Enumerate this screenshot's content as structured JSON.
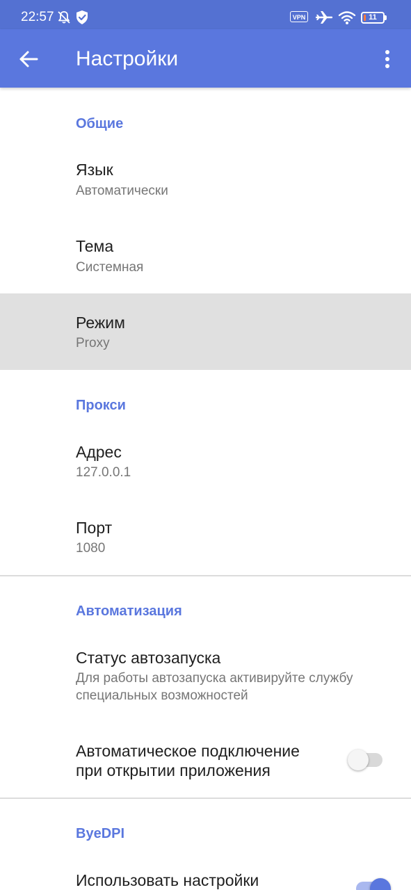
{
  "status_bar": {
    "time": "22:57",
    "vpn_label": "VPN",
    "battery_level": "11",
    "icons": [
      "muted-bell-icon",
      "shield-check-icon",
      "vpn-icon",
      "airplane-icon",
      "wifi-icon",
      "battery-icon"
    ]
  },
  "app_bar": {
    "title": "Настройки",
    "back_icon": "arrow-back-icon",
    "menu_icon": "more-vert-icon"
  },
  "sections": {
    "general": {
      "header": "Общие",
      "language": {
        "title": "Язык",
        "summary": "Автоматически"
      },
      "theme": {
        "title": "Тема",
        "summary": "Системная"
      },
      "mode": {
        "title": "Режим",
        "summary": "Proxy"
      }
    },
    "proxy": {
      "header": "Прокси",
      "address": {
        "title": "Адрес",
        "summary": "127.0.0.1"
      },
      "port": {
        "title": "Порт",
        "summary": "1080"
      }
    },
    "automation": {
      "header": "Автоматизация",
      "autostart_status": {
        "title": "Статус автозапуска",
        "summary_line1": "Для работы автозапуска активируйте службу",
        "summary_line2": "специальных возможностей"
      },
      "auto_connect": {
        "title_line1": "Автоматическое подключение",
        "title_line2": "при открытии приложения",
        "enabled": false
      }
    },
    "byedpi": {
      "header": "ByeDPI",
      "use_settings": {
        "title": "Использовать настройки",
        "enabled": true
      }
    }
  },
  "colors": {
    "status_bar": "#5471d2",
    "app_bar": "#5a77de",
    "accent": "#5a77de",
    "selected_row": "#e0e0e0",
    "switch_off_track": "#d9d9d9",
    "switch_off_thumb": "#f5f5f5",
    "switch_on_track": "#a9b8ef"
  }
}
